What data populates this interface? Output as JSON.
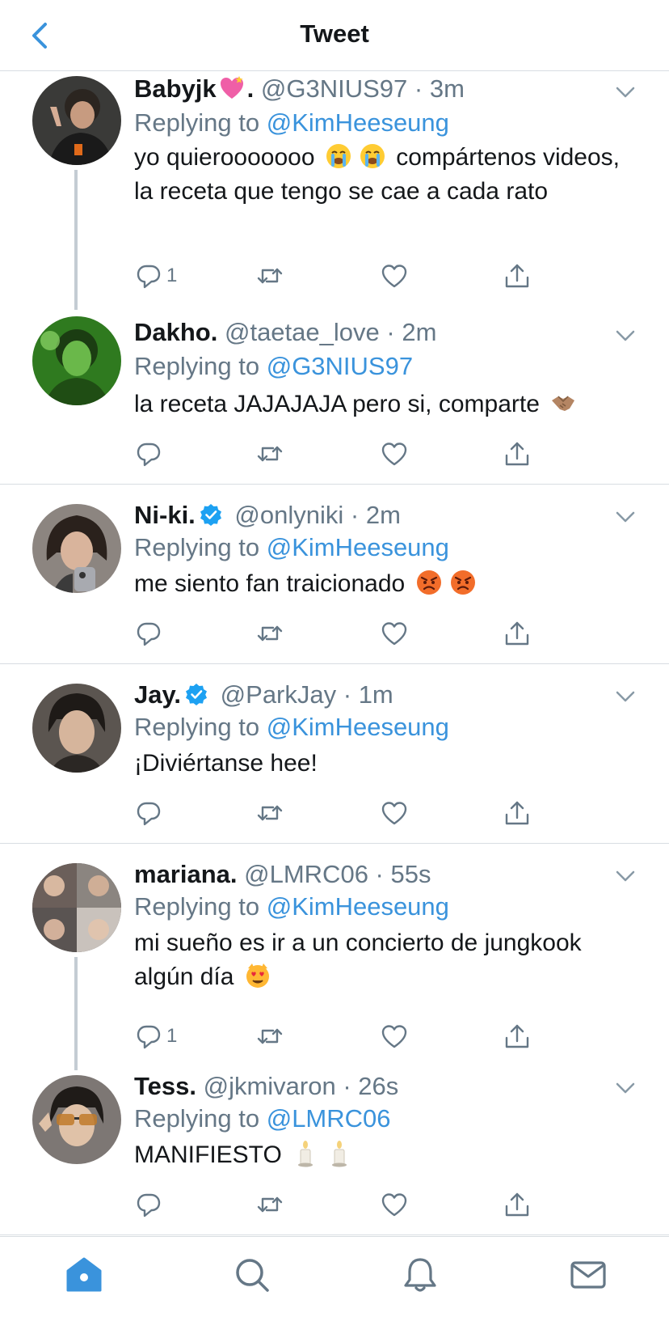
{
  "header": {
    "title": "Tweet"
  },
  "tweets": [
    {
      "name": "Babyjk",
      "name_suffix": ".",
      "handle": "@G3NIUS97",
      "time": "3m",
      "replying_prefix": "Replying to",
      "replying_to": "@KimHeeseung",
      "text_before": "yo quierooooooo ",
      "text_after": " compártenos videos, la receta que tengo se cae a cada rato",
      "reply_count": "1"
    },
    {
      "name": "Dakho.",
      "handle": "@taetae_love",
      "time": "2m",
      "replying_prefix": "Replying to",
      "replying_to": "@G3NIUS97",
      "text": "la receta JAJAJAJA pero si, comparte "
    },
    {
      "name": "Ni-ki.",
      "handle": "@onlyniki",
      "time": "2m",
      "replying_prefix": "Replying to",
      "replying_to": "@KimHeeseung",
      "text": "me siento fan traicionado "
    },
    {
      "name": "Jay.",
      "handle": "@ParkJay",
      "time": "1m",
      "replying_prefix": "Replying to",
      "replying_to": "@KimHeeseung",
      "text": "¡Diviértanse hee!"
    },
    {
      "name": "mariana.",
      "handle": "@LMRC06",
      "time": "55s",
      "replying_prefix": "Replying to",
      "replying_to": "@KimHeeseung",
      "text": "mi sueño es ir a un concierto de jungkook algún día ",
      "reply_count": "1"
    },
    {
      "name": "Tess.",
      "handle": "@jkmivaron",
      "time": "26s",
      "replying_prefix": "Replying to",
      "replying_to": "@LMRC06",
      "text": "MANIFIESTO "
    }
  ],
  "separator": " · ",
  "icons": {
    "back": "chevron-left-icon",
    "more": "chevron-down-icon",
    "reply": "reply-icon",
    "retweet": "retweet-icon",
    "like": "heart-icon",
    "share": "share-icon",
    "verified": "verified-badge-icon",
    "tabs": [
      "home-icon",
      "search-icon",
      "notifications-icon",
      "messages-icon"
    ]
  },
  "colors": {
    "accent": "#1da1f2",
    "mention": "#3a93dc",
    "muted": "#657786",
    "text": "#14171a",
    "divider": "#d8dde2"
  }
}
